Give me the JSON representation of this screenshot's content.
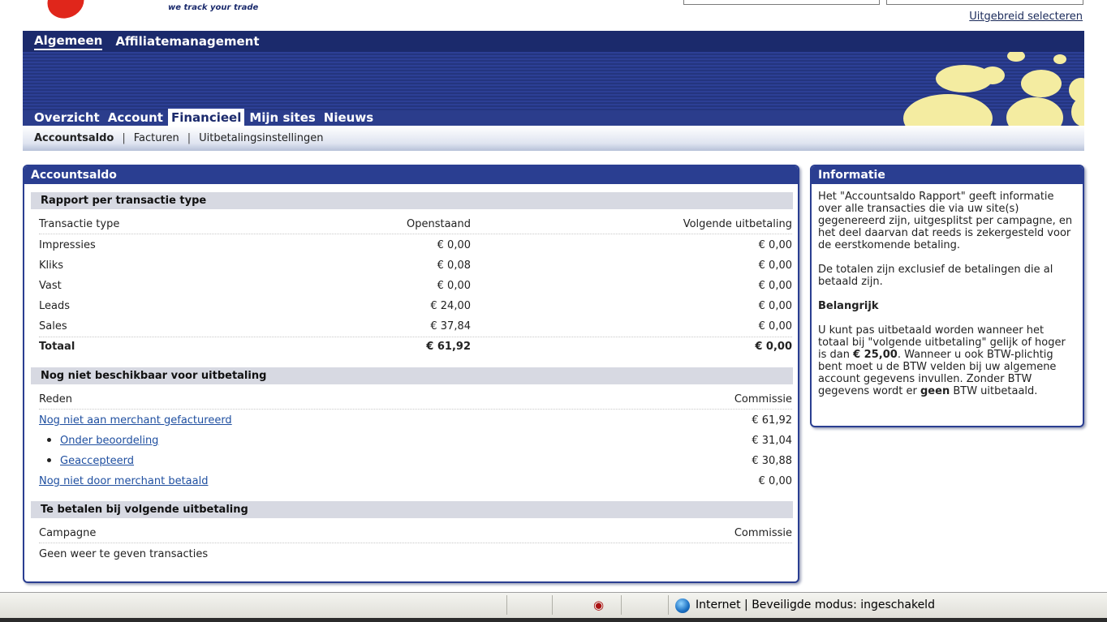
{
  "brand": {
    "tagline": "we track your trade"
  },
  "top": {
    "advanced_link": "Uitgebreid selecteren"
  },
  "main_nav": [
    "Algemeen",
    "Affiliatemanagement"
  ],
  "tabs": [
    "Overzicht",
    "Account",
    "Financieel",
    "Mijn sites",
    "Nieuws"
  ],
  "subnav": [
    "Accountsaldo",
    "Facturen",
    "Uitbetalingsinstellingen"
  ],
  "account_panel": {
    "title": "Accountsaldo",
    "section1": {
      "title": "Rapport per transactie type",
      "headers": [
        "Transactie type",
        "Openstaand",
        "Volgende uitbetaling"
      ],
      "rows": [
        [
          "Impressies",
          "€ 0,00",
          "€ 0,00"
        ],
        [
          "Kliks",
          "€ 0,08",
          "€ 0,00"
        ],
        [
          "Vast",
          "€ 0,00",
          "€ 0,00"
        ],
        [
          "Leads",
          "€ 24,00",
          "€ 0,00"
        ],
        [
          "Sales",
          "€ 37,84",
          "€ 0,00"
        ]
      ],
      "total": [
        "Totaal",
        "€ 61,92",
        "€ 0,00"
      ]
    },
    "section2": {
      "title": "Nog niet beschikbaar voor uitbetaling",
      "headers": [
        "Reden",
        "Commissie"
      ],
      "rows": [
        [
          "Nog niet aan merchant gefactureerd",
          "€ 61,92"
        ],
        [
          "Onder beoordeling",
          "€ 31,04"
        ],
        [
          "Geaccepteerd",
          "€ 30,88"
        ],
        [
          "Nog niet door merchant betaald",
          "€ 0,00"
        ]
      ]
    },
    "section3": {
      "title": "Te betalen bij volgende uitbetaling",
      "headers": [
        "Campagne",
        "Commissie"
      ],
      "empty": "Geen weer te geven transacties"
    }
  },
  "info_panel": {
    "title": "Informatie",
    "p1": "Het \"Accountsaldo Rapport\" geeft informatie over alle transacties die via uw site(s) gegenereerd zijn, uitgesplitst per campagne, en het deel daarvan dat reeds is zekergesteld voor de eerstkomende betaling.",
    "p2": "De totalen zijn exclusief de betalingen die al betaald zijn.",
    "important": "Belangrijk",
    "p3a": "U kunt pas uitbetaald worden wanneer het totaal bij \"volgende uitbetaling\" gelijk of hoger is dan ",
    "p3b": "€ 25,00",
    "p3c": ". Wanneer u ook BTW-plichtig bent moet u de BTW velden bij uw algemene account gegevens invullen. Zonder BTW gegevens wordt er ",
    "p3d": "geen",
    "p3e": " BTW uitbetaald."
  },
  "statusbar": {
    "text": "Internet | Beveiligde modus: ingeschakeld"
  },
  "colors": {
    "header_blue": "#2b3d8c",
    "nav_dark": "#1b2a6c",
    "panel_blue": "#2a3e91",
    "section_gray": "#d7d9e2",
    "link_blue": "#1f4fa0",
    "dot_yellow": "#f4eca1",
    "logo_red": "#e0261b"
  }
}
